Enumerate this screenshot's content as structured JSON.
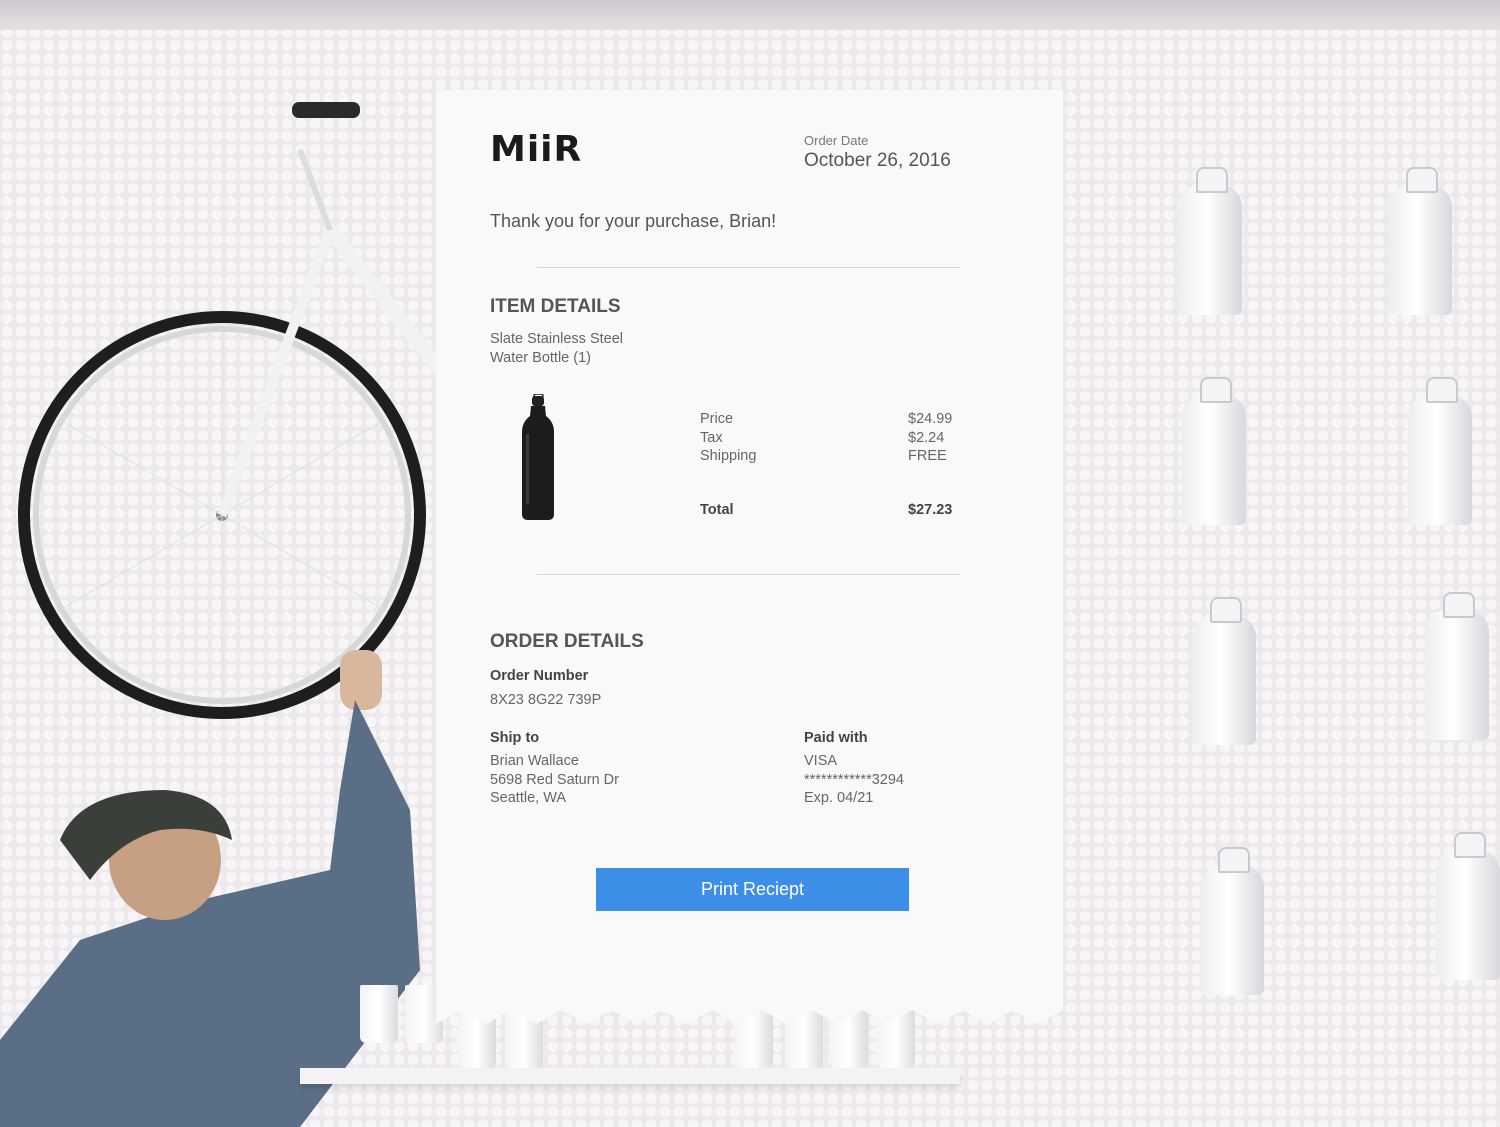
{
  "brand": {
    "logo_text": "MiiR"
  },
  "header": {
    "order_date_label": "Order Date",
    "order_date": "October 26, 2016"
  },
  "greeting": "Thank you for your purchase, Brian!",
  "item_details": {
    "heading": "ITEM DETAILS",
    "item_name_line1": "Slate Stainless Steel",
    "item_name_line2": "Water Bottle (1)",
    "price_label": "Price",
    "price_value": "$24.99",
    "tax_label": "Tax",
    "tax_value": "$2.24",
    "shipping_label": "Shipping",
    "shipping_value": "FREE",
    "total_label": "Total",
    "total_value": "$27.23"
  },
  "order_details": {
    "heading": "ORDER DETAILS",
    "order_number_label": "Order Number",
    "order_number": "8X23 8G22 739P",
    "ship_to_label": "Ship to",
    "ship_name": "Brian Wallace",
    "ship_street": "5698 Red Saturn Dr",
    "ship_city": "Seattle, WA",
    "paid_with_label": "Paid with",
    "card_type": "VISA",
    "card_number": "************3294",
    "card_exp": "Exp. 04/21"
  },
  "actions": {
    "print_label": "Print Reciept"
  },
  "colors": {
    "accent": "#3d8ee6",
    "paper": "#f9f9f9"
  },
  "icons": {
    "product_image": "bottle-icon"
  }
}
